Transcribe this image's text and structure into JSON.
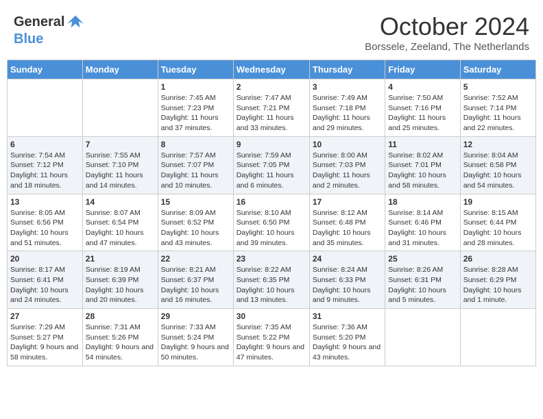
{
  "header": {
    "logo_general": "General",
    "logo_blue": "Blue",
    "month": "October 2024",
    "location": "Borssele, Zeeland, The Netherlands"
  },
  "days_of_week": [
    "Sunday",
    "Monday",
    "Tuesday",
    "Wednesday",
    "Thursday",
    "Friday",
    "Saturday"
  ],
  "weeks": [
    [
      {
        "day": "",
        "info": ""
      },
      {
        "day": "",
        "info": ""
      },
      {
        "day": "1",
        "info": "Sunrise: 7:45 AM\nSunset: 7:23 PM\nDaylight: 11 hours and 37 minutes."
      },
      {
        "day": "2",
        "info": "Sunrise: 7:47 AM\nSunset: 7:21 PM\nDaylight: 11 hours and 33 minutes."
      },
      {
        "day": "3",
        "info": "Sunrise: 7:49 AM\nSunset: 7:18 PM\nDaylight: 11 hours and 29 minutes."
      },
      {
        "day": "4",
        "info": "Sunrise: 7:50 AM\nSunset: 7:16 PM\nDaylight: 11 hours and 25 minutes."
      },
      {
        "day": "5",
        "info": "Sunrise: 7:52 AM\nSunset: 7:14 PM\nDaylight: 11 hours and 22 minutes."
      }
    ],
    [
      {
        "day": "6",
        "info": "Sunrise: 7:54 AM\nSunset: 7:12 PM\nDaylight: 11 hours and 18 minutes."
      },
      {
        "day": "7",
        "info": "Sunrise: 7:55 AM\nSunset: 7:10 PM\nDaylight: 11 hours and 14 minutes."
      },
      {
        "day": "8",
        "info": "Sunrise: 7:57 AM\nSunset: 7:07 PM\nDaylight: 11 hours and 10 minutes."
      },
      {
        "day": "9",
        "info": "Sunrise: 7:59 AM\nSunset: 7:05 PM\nDaylight: 11 hours and 6 minutes."
      },
      {
        "day": "10",
        "info": "Sunrise: 8:00 AM\nSunset: 7:03 PM\nDaylight: 11 hours and 2 minutes."
      },
      {
        "day": "11",
        "info": "Sunrise: 8:02 AM\nSunset: 7:01 PM\nDaylight: 10 hours and 58 minutes."
      },
      {
        "day": "12",
        "info": "Sunrise: 8:04 AM\nSunset: 6:58 PM\nDaylight: 10 hours and 54 minutes."
      }
    ],
    [
      {
        "day": "13",
        "info": "Sunrise: 8:05 AM\nSunset: 6:56 PM\nDaylight: 10 hours and 51 minutes."
      },
      {
        "day": "14",
        "info": "Sunrise: 8:07 AM\nSunset: 6:54 PM\nDaylight: 10 hours and 47 minutes."
      },
      {
        "day": "15",
        "info": "Sunrise: 8:09 AM\nSunset: 6:52 PM\nDaylight: 10 hours and 43 minutes."
      },
      {
        "day": "16",
        "info": "Sunrise: 8:10 AM\nSunset: 6:50 PM\nDaylight: 10 hours and 39 minutes."
      },
      {
        "day": "17",
        "info": "Sunrise: 8:12 AM\nSunset: 6:48 PM\nDaylight: 10 hours and 35 minutes."
      },
      {
        "day": "18",
        "info": "Sunrise: 8:14 AM\nSunset: 6:46 PM\nDaylight: 10 hours and 31 minutes."
      },
      {
        "day": "19",
        "info": "Sunrise: 8:15 AM\nSunset: 6:44 PM\nDaylight: 10 hours and 28 minutes."
      }
    ],
    [
      {
        "day": "20",
        "info": "Sunrise: 8:17 AM\nSunset: 6:41 PM\nDaylight: 10 hours and 24 minutes."
      },
      {
        "day": "21",
        "info": "Sunrise: 8:19 AM\nSunset: 6:39 PM\nDaylight: 10 hours and 20 minutes."
      },
      {
        "day": "22",
        "info": "Sunrise: 8:21 AM\nSunset: 6:37 PM\nDaylight: 10 hours and 16 minutes."
      },
      {
        "day": "23",
        "info": "Sunrise: 8:22 AM\nSunset: 6:35 PM\nDaylight: 10 hours and 13 minutes."
      },
      {
        "day": "24",
        "info": "Sunrise: 8:24 AM\nSunset: 6:33 PM\nDaylight: 10 hours and 9 minutes."
      },
      {
        "day": "25",
        "info": "Sunrise: 8:26 AM\nSunset: 6:31 PM\nDaylight: 10 hours and 5 minutes."
      },
      {
        "day": "26",
        "info": "Sunrise: 8:28 AM\nSunset: 6:29 PM\nDaylight: 10 hours and 1 minute."
      }
    ],
    [
      {
        "day": "27",
        "info": "Sunrise: 7:29 AM\nSunset: 5:27 PM\nDaylight: 9 hours and 58 minutes."
      },
      {
        "day": "28",
        "info": "Sunrise: 7:31 AM\nSunset: 5:26 PM\nDaylight: 9 hours and 54 minutes."
      },
      {
        "day": "29",
        "info": "Sunrise: 7:33 AM\nSunset: 5:24 PM\nDaylight: 9 hours and 50 minutes."
      },
      {
        "day": "30",
        "info": "Sunrise: 7:35 AM\nSunset: 5:22 PM\nDaylight: 9 hours and 47 minutes."
      },
      {
        "day": "31",
        "info": "Sunrise: 7:36 AM\nSunset: 5:20 PM\nDaylight: 9 hours and 43 minutes."
      },
      {
        "day": "",
        "info": ""
      },
      {
        "day": "",
        "info": ""
      }
    ]
  ]
}
